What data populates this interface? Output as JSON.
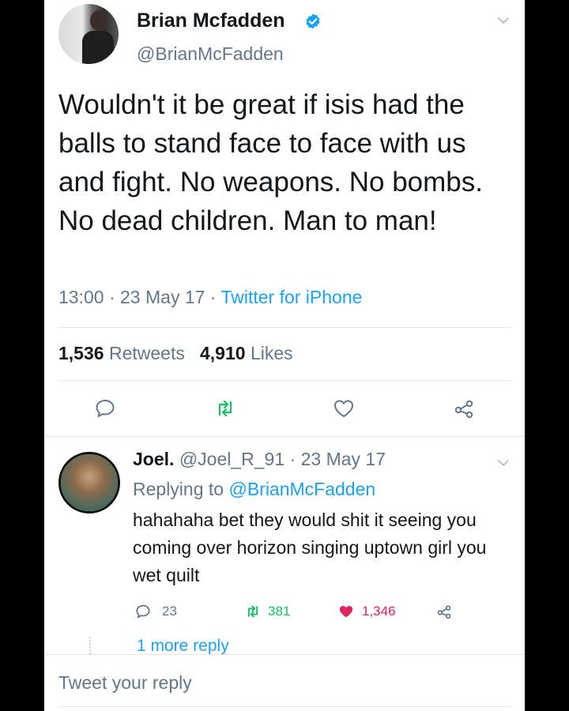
{
  "tweet": {
    "author_name": "Brian Mcfadden",
    "author_handle": "@BrianMcFadden",
    "text": "Wouldn't it be great if isis had the balls to stand face to face with us and fight. No weapons. No bombs. No dead children. Man to man!",
    "time": "13:00",
    "date": "23 May 17",
    "source": "Twitter for iPhone",
    "separator": " · ",
    "retweets_count": "1,536",
    "retweets_label": "Retweets",
    "likes_count": "4,910",
    "likes_label": "Likes"
  },
  "reply": {
    "author_name": "Joel.",
    "author_handle": "@Joel_R_91",
    "date": "23 May 17",
    "replying_prefix": "Replying to",
    "replying_to": "@BrianMcFadden",
    "text": "hahahaha bet they would shit it seeing you coming over horizon singing uptown girl you wet quilt",
    "reply_count": "23",
    "retweet_count": "381",
    "like_count": "1,346",
    "more_replies": "1 more reply"
  },
  "composer": {
    "placeholder": "Tweet your reply"
  },
  "icons": {
    "verified": "verified-badge-icon",
    "chevron": "chevron-down-icon",
    "reply": "reply-icon",
    "retweet": "retweet-icon",
    "like": "heart-icon",
    "share": "share-icon"
  },
  "colors": {
    "accent": "#1da1f2",
    "retweet": "#17bf63",
    "like": "#e0245e",
    "text": "#14171a",
    "muted": "#657786"
  }
}
